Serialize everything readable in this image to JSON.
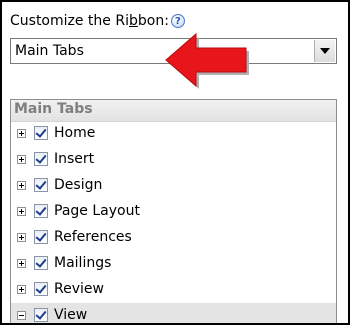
{
  "dialog": {
    "title_prefix": "Customize the Ri",
    "title_underlined": "b",
    "title_suffix": "bon:",
    "help_icon": "?"
  },
  "tabs_dropdown": {
    "selected": "Main Tabs"
  },
  "annotation": {
    "arrow_color": "#e8151b",
    "arrow_icon": "left-arrow-icon"
  },
  "tree": {
    "header": "Main Tabs",
    "items": [
      {
        "label": "Home",
        "checked": true,
        "expanded": false
      },
      {
        "label": "Insert",
        "checked": true,
        "expanded": false
      },
      {
        "label": "Design",
        "checked": true,
        "expanded": false
      },
      {
        "label": "Page Layout",
        "checked": true,
        "expanded": false
      },
      {
        "label": "References",
        "checked": true,
        "expanded": false
      },
      {
        "label": "Mailings",
        "checked": true,
        "expanded": false
      },
      {
        "label": "Review",
        "checked": true,
        "expanded": false
      },
      {
        "label": "View",
        "checked": true,
        "expanded": true,
        "selected": true
      }
    ]
  }
}
